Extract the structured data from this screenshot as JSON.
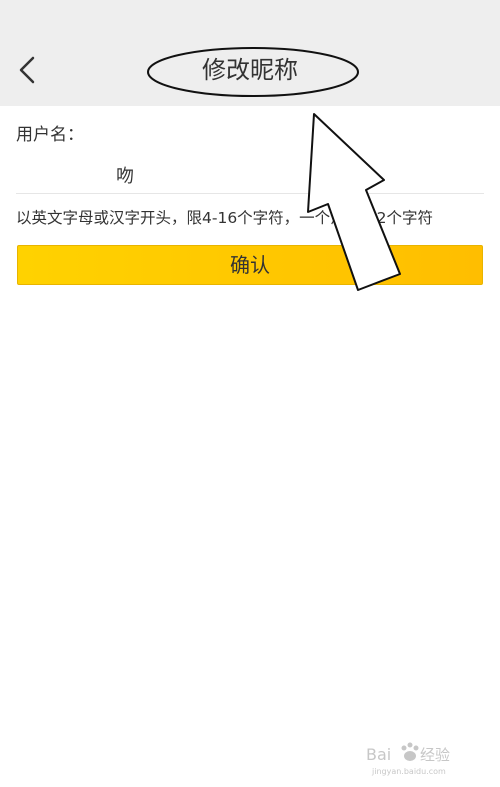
{
  "header": {
    "title": "修改昵称",
    "background": "#eeeeee"
  },
  "form": {
    "username_label": "用户名：",
    "username_value": "吻",
    "hint": "以英文字母或汉字开头，限4-16个字符，一个汉字为2个字符",
    "confirm_label": "确认"
  },
  "colors": {
    "button_start": "#ffd200",
    "button_end": "#ffbe00"
  },
  "icons": {
    "back": "chevron-left-icon"
  },
  "annotations": {
    "title_highlight": "ellipse",
    "arrow": "pointing-up"
  },
  "watermark": {
    "brand": "Baidu经验"
  }
}
